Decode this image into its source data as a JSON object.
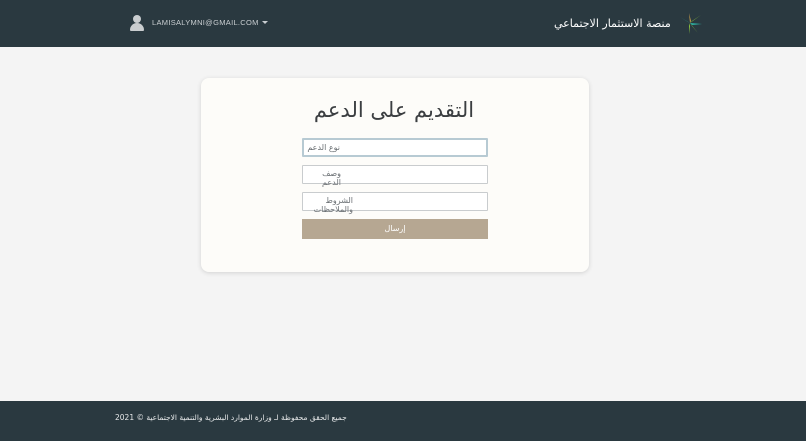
{
  "header": {
    "user_email": "LAMISALYMNI@GMAIL.COM",
    "brand_name": "منصة الاستثمار الاجتماعي",
    "colors": {
      "bar": "#2a3940",
      "logo_green": "#8cc63f",
      "logo_gold": "#c8a04a"
    }
  },
  "form": {
    "title": "التقديم على الدعم",
    "support_type_placeholder": "نوع الدعم",
    "support_description_placeholder": "وصف الدعم",
    "terms_notes_placeholder": "الشروط والملاحظات",
    "submit_label": "إرسال",
    "submit_color": "#b6a792"
  },
  "footer": {
    "copyright": "جميع الحقق محفوظة لـ وزارة الموارد البشرية والتنمية الاجتماعية © 2021"
  }
}
